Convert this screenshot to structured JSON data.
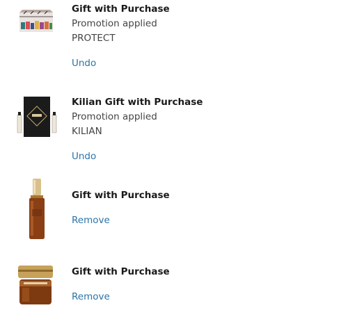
{
  "items": [
    {
      "title": "Gift with Purchase",
      "status": "Promotion applied",
      "code": "PROTECT",
      "action": "Undo",
      "image_icon": "makeup-bag-icon"
    },
    {
      "title": "Kilian Gift with Purchase",
      "status": "Promotion applied",
      "code": "KILIAN",
      "action": "Undo",
      "image_icon": "fragrance-sample-icon"
    },
    {
      "title": "Gift with Purchase",
      "action": "Remove",
      "image_icon": "serum-bottle-icon"
    },
    {
      "title": "Gift with Purchase",
      "action": "Remove",
      "image_icon": "eye-cream-jar-icon"
    }
  ],
  "colors": {
    "link": "#2a74a8",
    "title": "#1a1a1a",
    "secondary_text": "#444444"
  }
}
